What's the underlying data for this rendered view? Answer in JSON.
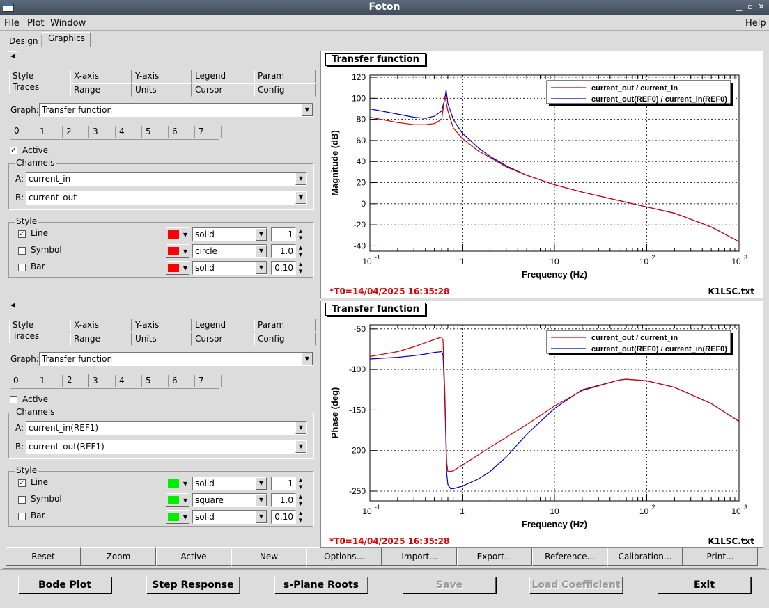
{
  "window": {
    "title": "Foton"
  },
  "menu": {
    "file": "File",
    "plot": "Plot",
    "window": "Window",
    "help": "Help"
  },
  "top_tabs": [
    "Design",
    "Graphics"
  ],
  "panes": [
    {
      "tabs_row1": [
        "Style",
        "X-axis",
        "Y-axis",
        "Legend",
        "Param"
      ],
      "tabs_row2": [
        "Traces",
        "Range",
        "Units",
        "Cursor",
        "Config"
      ],
      "graph_label": "Graph:",
      "graph_value": "Transfer function",
      "trace_tabs": [
        "0",
        "1",
        "2",
        "3",
        "4",
        "5",
        "6",
        "7"
      ],
      "selected_trace": 0,
      "active_label": "Active",
      "active_checked": true,
      "channels_title": "Channels",
      "a_label": "A:",
      "a_value": "current_in",
      "b_label": "B:",
      "b_value": "current_out",
      "style_title": "Style",
      "color": "#ff0000",
      "rows": [
        {
          "label": "Line",
          "checked": true,
          "style": "solid",
          "num": "1"
        },
        {
          "label": "Symbol",
          "checked": false,
          "style": "circle",
          "num": "1.0"
        },
        {
          "label": "Bar",
          "checked": false,
          "style": "solid",
          "num": "0.10"
        }
      ]
    },
    {
      "tabs_row1": [
        "Style",
        "X-axis",
        "Y-axis",
        "Legend",
        "Param"
      ],
      "tabs_row2": [
        "Traces",
        "Range",
        "Units",
        "Cursor",
        "Config"
      ],
      "graph_label": "Graph:",
      "graph_value": "Transfer function",
      "trace_tabs": [
        "0",
        "1",
        "2",
        "3",
        "4",
        "5",
        "6",
        "7"
      ],
      "selected_trace": 2,
      "active_label": "Active",
      "active_checked": false,
      "channels_title": "Channels",
      "a_label": "A:",
      "a_value": "current_in(REF1)",
      "b_label": "B:",
      "b_value": "current_out(REF1)",
      "style_title": "Style",
      "color": "#00ee00",
      "rows": [
        {
          "label": "Line",
          "checked": true,
          "style": "solid",
          "num": "1"
        },
        {
          "label": "Symbol",
          "checked": false,
          "style": "square",
          "num": "1.0"
        },
        {
          "label": "Bar",
          "checked": false,
          "style": "solid",
          "num": "0.10"
        }
      ]
    }
  ],
  "plots": [
    {
      "title": "Transfer function",
      "t0": "*T0=14/04/2025 16:35:28",
      "filename": "K1LSC.txt"
    },
    {
      "title": "Transfer function",
      "t0": "*T0=14/04/2025 16:35:28",
      "filename": "K1LSC.txt"
    }
  ],
  "chart_data": [
    {
      "type": "line",
      "xlabel": "Frequency (Hz)",
      "ylabel": "Magnitude (dB)",
      "xscale": "log",
      "xlim": [
        0.1,
        1000
      ],
      "ylim": [
        -45,
        122
      ],
      "yticks": [
        -40,
        -20,
        0,
        20,
        40,
        60,
        80,
        100,
        120
      ],
      "xticklabels": [
        "10",
        "1",
        "10",
        "10",
        "10"
      ],
      "xtick_exponents": [
        "-1",
        "",
        "",
        "2",
        "3"
      ],
      "grid": true,
      "legend_position": "top-right",
      "series": [
        {
          "name": "current_out / current_in",
          "color": "#d00000",
          "x": [
            0.1,
            0.2,
            0.3,
            0.4,
            0.5,
            0.6,
            0.65,
            0.7,
            0.8,
            1,
            1.5,
            2,
            3,
            5,
            10,
            20,
            50,
            100,
            200,
            500,
            1000
          ],
          "y": [
            82,
            77,
            75,
            75,
            76,
            80,
            102,
            88,
            72,
            62,
            50,
            44,
            35,
            27,
            18,
            11,
            3,
            -3,
            -9,
            -22,
            -36
          ]
        },
        {
          "name": "current_out(REF0) / current_in(REF0)",
          "color": "#0000c8",
          "x": [
            0.1,
            0.2,
            0.3,
            0.4,
            0.5,
            0.6,
            0.65,
            0.67,
            0.7,
            0.8,
            1,
            1.5,
            2,
            3,
            5,
            10,
            20,
            50,
            100,
            200,
            500,
            1000
          ],
          "y": [
            90,
            85,
            82,
            81,
            83,
            88,
            100,
            108,
            95,
            80,
            67,
            53,
            45,
            36,
            27,
            18,
            11,
            3,
            -3,
            -9,
            -22,
            -36
          ]
        }
      ]
    },
    {
      "type": "line",
      "xlabel": "Frequency (Hz)",
      "ylabel": "Phase (deg)",
      "xscale": "log",
      "xlim": [
        0.1,
        1000
      ],
      "ylim": [
        -262,
        -45
      ],
      "yticks": [
        -50,
        -100,
        -150,
        -200,
        -250
      ],
      "xticklabels": [
        "10",
        "1",
        "10",
        "10",
        "10"
      ],
      "xtick_exponents": [
        "-1",
        "",
        "",
        "2",
        "3"
      ],
      "grid": true,
      "legend_position": "top-right",
      "series": [
        {
          "name": "current_out / current_in",
          "color": "#d00000",
          "x": [
            0.1,
            0.2,
            0.3,
            0.4,
            0.5,
            0.6,
            0.62,
            0.65,
            0.68,
            0.7,
            0.8,
            1,
            2,
            5,
            10,
            20,
            50,
            60,
            100,
            200,
            500,
            1000
          ],
          "y": [
            -84,
            -78,
            -72,
            -67,
            -63,
            -60,
            -64,
            -130,
            -215,
            -226,
            -225,
            -218,
            -196,
            -168,
            -145,
            -126,
            -113,
            -112,
            -114,
            -122,
            -142,
            -164
          ]
        },
        {
          "name": "current_out(REF0) / current_in(REF0)",
          "color": "#0000c8",
          "x": [
            0.1,
            0.2,
            0.3,
            0.4,
            0.5,
            0.6,
            0.62,
            0.65,
            0.68,
            0.7,
            0.75,
            0.8,
            1,
            1.5,
            2,
            3,
            5,
            10,
            20,
            50,
            60,
            100,
            200,
            500,
            1000
          ],
          "y": [
            -87,
            -85,
            -83,
            -81,
            -79,
            -78,
            -82,
            -140,
            -228,
            -242,
            -247,
            -247,
            -244,
            -235,
            -226,
            -208,
            -180,
            -148,
            -125,
            -113,
            -112,
            -114,
            -122,
            -142,
            -164
          ]
        }
      ]
    }
  ],
  "bottom_buttons": [
    "Reset",
    "Zoom",
    "Active",
    "New",
    "Options...",
    "Import...",
    "Export...",
    "Reference...",
    "Calibration...",
    "Print..."
  ],
  "footer_buttons": [
    {
      "label": "Bode Plot",
      "enabled": true
    },
    {
      "label": "Step Response",
      "enabled": true
    },
    {
      "label": "s-Plane Roots",
      "enabled": true
    },
    {
      "label": "Save",
      "enabled": false
    },
    {
      "label": "Load Coefficient",
      "enabled": false
    },
    {
      "label": "Exit",
      "enabled": true
    }
  ]
}
